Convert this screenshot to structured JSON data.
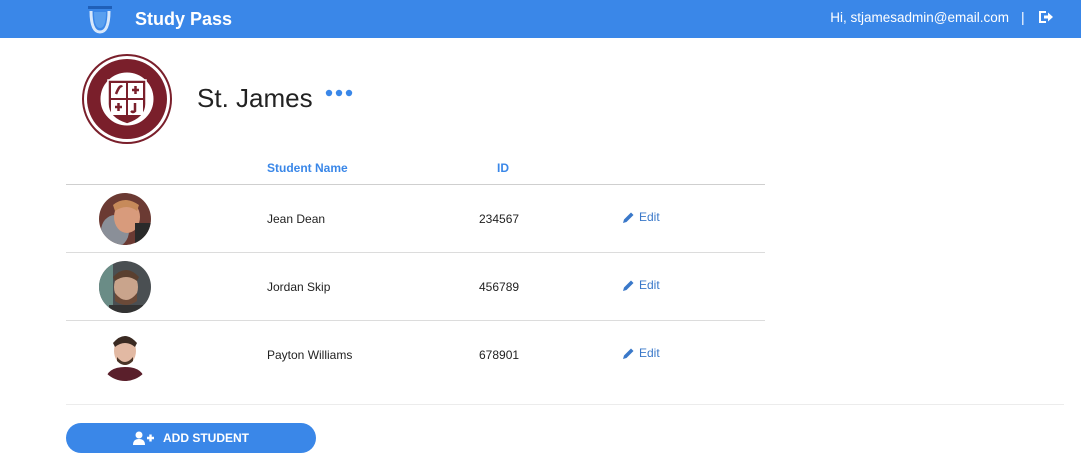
{
  "navbar": {
    "app_title": "Study Pass",
    "greeting": "Hi, stjamesadmin@email.com",
    "divider": "|",
    "logo_icon": "graduation-cap-icon",
    "logout_icon": "sign-out-icon",
    "color": "#3a87e8"
  },
  "school": {
    "name": "St. James",
    "more_icon": "ellipsis-icon",
    "seal_icon": "school-seal-icon"
  },
  "table": {
    "headers": {
      "name": "Student Name",
      "id": "ID"
    },
    "rows": [
      {
        "name": "Jean Dean",
        "id": "234567",
        "edit": "Edit"
      },
      {
        "name": "Jordan Skip",
        "id": "456789",
        "edit": "Edit"
      },
      {
        "name": "Payton Williams",
        "id": "678901",
        "edit": "Edit"
      }
    ]
  },
  "actions": {
    "add_student": "ADD STUDENT",
    "add_icon": "add-user-icon"
  }
}
